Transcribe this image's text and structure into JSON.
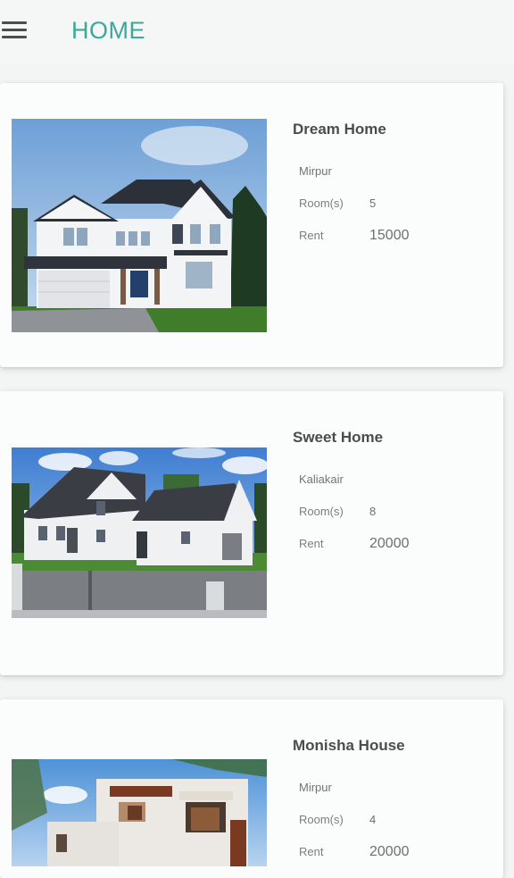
{
  "appbar": {
    "title": "HOME",
    "menu_icon": "hamburger-menu-icon",
    "title_color": "#3aa89a"
  },
  "listings": [
    {
      "title": "Dream Home",
      "location": "Mirpur",
      "rooms_label": "Room(s)",
      "rooms": "5",
      "rent_label": "Rent",
      "rent": "15000"
    },
    {
      "title": "Sweet Home",
      "location": "Kaliakair",
      "rooms_label": "Room(s)",
      "rooms": "8",
      "rent_label": "Rent",
      "rent": "20000"
    },
    {
      "title": "Monisha House",
      "location": "Mirpur",
      "rooms_label": "Room(s)",
      "rooms": "4",
      "rent_label": "Rent",
      "rent": "20000"
    }
  ]
}
